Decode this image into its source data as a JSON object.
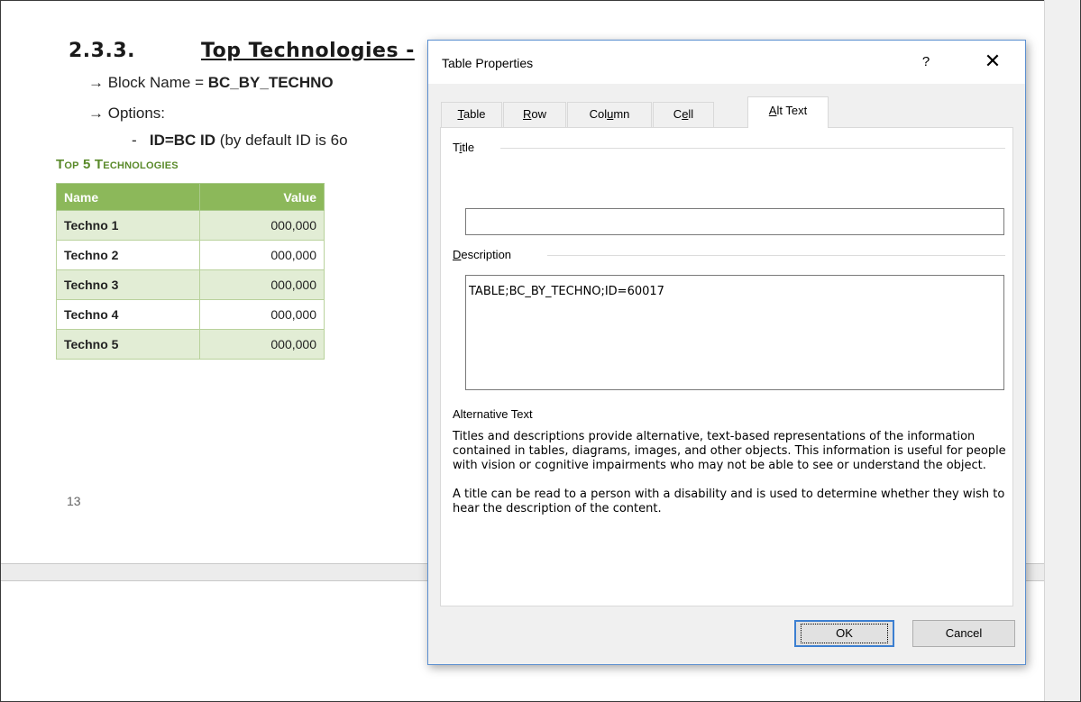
{
  "document": {
    "heading": {
      "number": "2.3.3.",
      "title": "Top Technologies -"
    },
    "bullets": {
      "block_name_label": "→ Block Name = ",
      "block_name_value": "BC_BY_TECHNO",
      "options_label": "→ Options:",
      "option_dash": "-",
      "option_bold": "ID=BC ID",
      "option_rest": " (by default ID is 6o"
    },
    "table_title": "Top 5 Technologies",
    "table": {
      "headers": [
        "Name",
        "Value"
      ],
      "rows": [
        [
          "Techno 1",
          "000,000"
        ],
        [
          "Techno 2",
          "000,000"
        ],
        [
          "Techno 3",
          "000,000"
        ],
        [
          "Techno 4",
          "000,000"
        ],
        [
          "Techno 5",
          "000,000"
        ]
      ]
    },
    "page_number": "13"
  },
  "dialog": {
    "title": "Table Properties",
    "help_label": "?",
    "close_label": "✕",
    "tabs": [
      {
        "pre": "",
        "u": "T",
        "post": "able"
      },
      {
        "pre": "",
        "u": "R",
        "post": "ow"
      },
      {
        "pre": "Col",
        "u": "u",
        "post": "mn"
      },
      {
        "pre": "C",
        "u": "e",
        "post": "ll"
      },
      {
        "pre": "",
        "u": "A",
        "post": "lt Text"
      }
    ],
    "active_tab": "Alt Text",
    "title_group": {
      "pre": "T",
      "u": "i",
      "post": "tle"
    },
    "title_value": "",
    "description_group": {
      "pre": "",
      "u": "D",
      "post": "escription"
    },
    "description_value": "TABLE;BC_BY_TECHNO;ID=60017",
    "alt_heading": "Alternative Text",
    "alt_paragraph_1": "Titles and descriptions provide alternative, text-based representations of the information contained in tables, diagrams, images, and other objects. This information is useful for people with vision or cognitive impairments who may not be able to see or understand the object.",
    "alt_paragraph_2": "A title can be read to a person with a disability and is used to determine whether they wish to hear the description of the content.",
    "ok_label": "OK",
    "cancel_label": "Cancel"
  },
  "colors": {
    "table_header": "#8cb85a",
    "table_band": "#e2edd5",
    "table_title": "#5a8a2a",
    "dialog_border": "#5b8fd0",
    "ok_border": "#3c7fd1"
  }
}
